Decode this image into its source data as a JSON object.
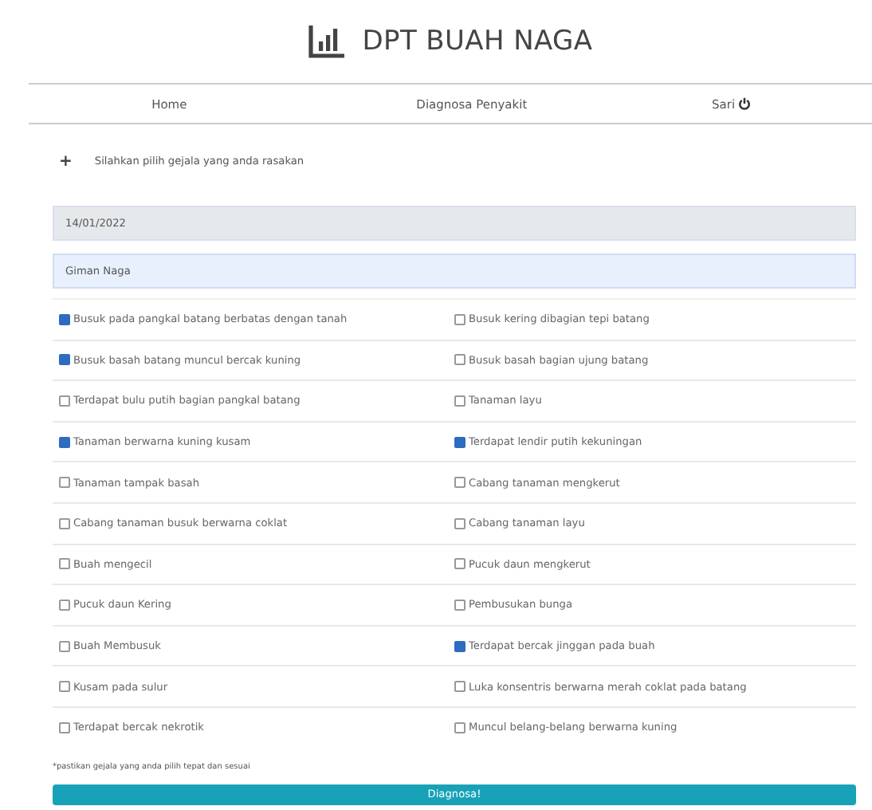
{
  "header": {
    "title": "DPT BUAH NAGA"
  },
  "nav": {
    "items": [
      {
        "label": "Home"
      },
      {
        "label": "Diagnosa Penyakit"
      },
      {
        "label": "Sari",
        "kind": "logout"
      }
    ]
  },
  "form": {
    "prompt_icon": "+",
    "prompt": "Silahkan pilih gejala yang anda rasakan",
    "date": "14/01/2022",
    "name": "Giman Naga",
    "rows": [
      [
        {
          "label": "Busuk pada pangkal batang berbatas dengan tanah",
          "checked": true
        },
        {
          "label": "Busuk kering dibagian tepi batang",
          "checked": false
        }
      ],
      [
        {
          "label": "Busuk basah batang muncul bercak kuning",
          "checked": true
        },
        {
          "label": "Busuk basah bagian ujung batang",
          "checked": false
        }
      ],
      [
        {
          "label": "Terdapat bulu putih bagian pangkal batang",
          "checked": false
        },
        {
          "label": "Tanaman layu",
          "checked": false
        }
      ],
      [
        {
          "label": "Tanaman berwarna kuning kusam",
          "checked": true
        },
        {
          "label": "Terdapat lendir putih kekuningan",
          "checked": true
        }
      ],
      [
        {
          "label": "Tanaman tampak basah",
          "checked": false
        },
        {
          "label": "Cabang tanaman mengkerut",
          "checked": false
        }
      ],
      [
        {
          "label": "Cabang tanaman busuk berwarna coklat",
          "checked": false
        },
        {
          "label": "Cabang tanaman layu",
          "checked": false
        }
      ],
      [
        {
          "label": "Buah mengecil",
          "checked": false
        },
        {
          "label": "Pucuk daun mengkerut",
          "checked": false
        }
      ],
      [
        {
          "label": "Pucuk daun Kering",
          "checked": false
        },
        {
          "label": "Pembusukan bunga",
          "checked": false
        }
      ],
      [
        {
          "label": "Buah Membusuk",
          "checked": false
        },
        {
          "label": "Terdapat bercak jinggan pada buah",
          "checked": true
        }
      ],
      [
        {
          "label": "Kusam pada sulur",
          "checked": false
        },
        {
          "label": "Luka konsentris berwarna merah coklat pada batang",
          "checked": false
        }
      ],
      [
        {
          "label": "Terdapat bercak nekrotik",
          "checked": false
        },
        {
          "label": "Muncul belang-belang berwarna kuning",
          "checked": false
        }
      ]
    ],
    "note": "*pastikan gejala yang anda pilih tepat dan sesuai",
    "submit": "Diagnosa!"
  }
}
